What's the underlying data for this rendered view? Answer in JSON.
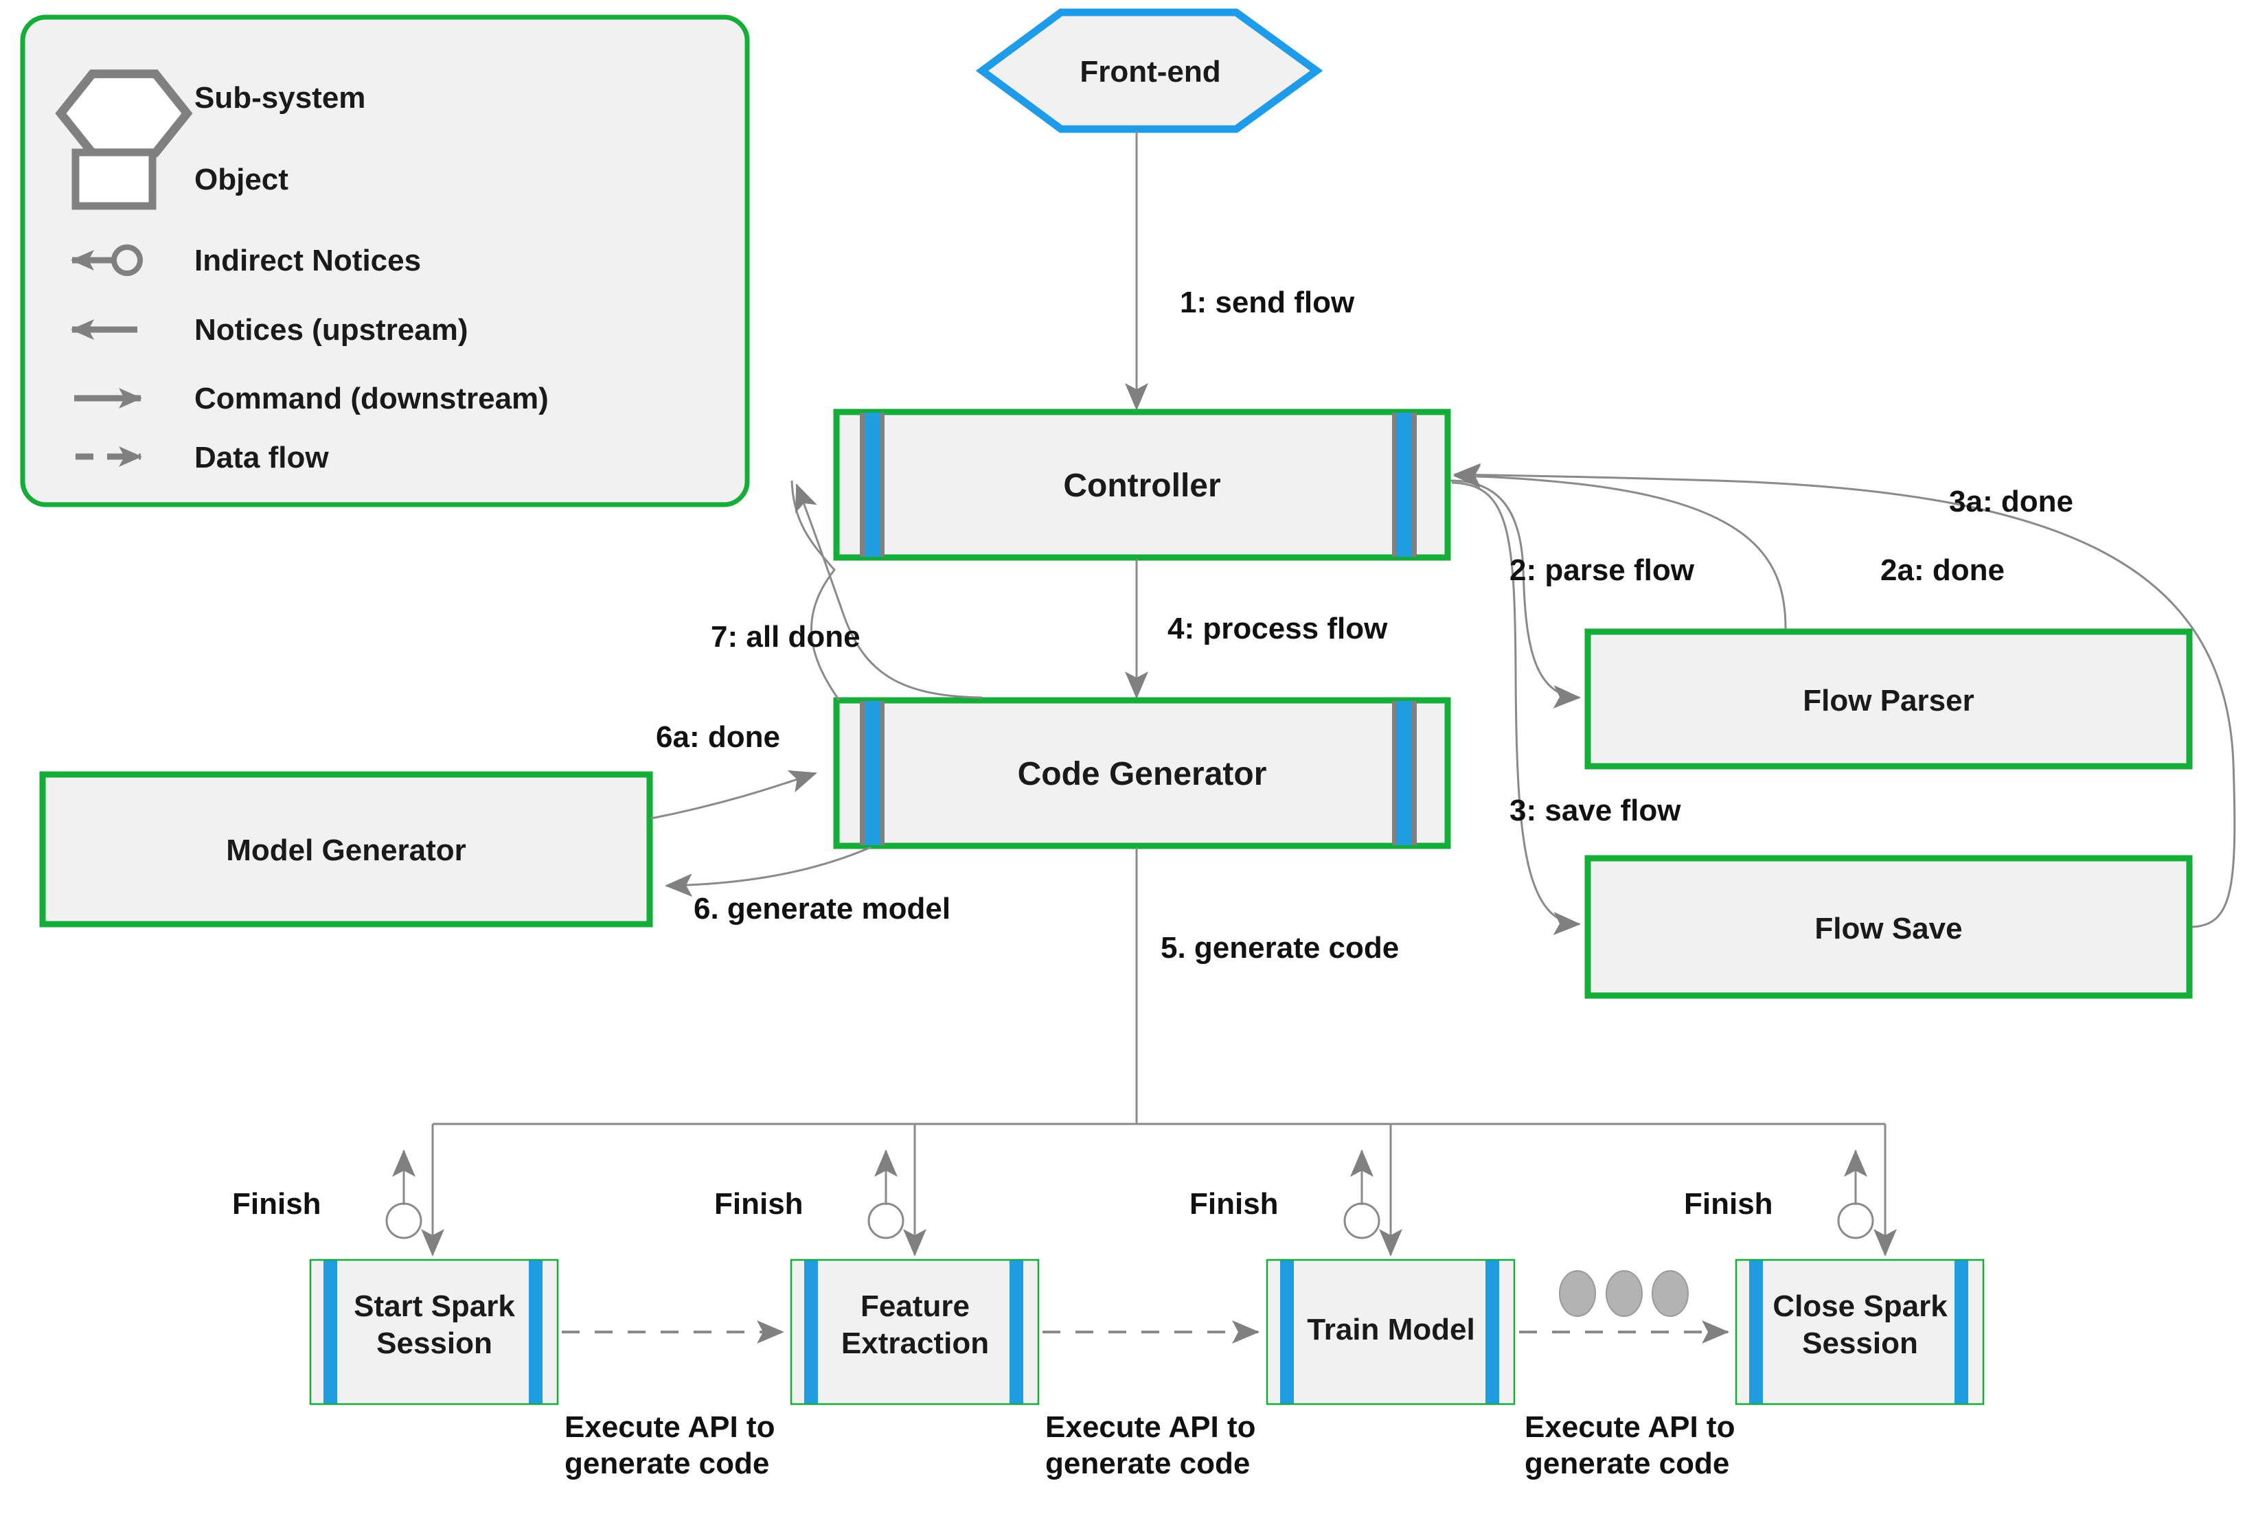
{
  "diagram": {
    "title": "Flow-to-code generation sub-system interaction diagram",
    "colors": {
      "green_border": "#13ad38",
      "blue_stripe": "#1f9de0",
      "gray_stripe": "#808080",
      "node_fill": "#f1f1f1",
      "front_end_border": "#1e9cea",
      "arrow_gray": "#808080",
      "line_gray": "#8a8a8a",
      "text": "#1a1a1a"
    }
  },
  "legend": {
    "title": "",
    "items": [
      {
        "icon": "hexagon-icon",
        "label": "Sub-system"
      },
      {
        "icon": "rectangle-icon",
        "label": "Object"
      },
      {
        "icon": "indirect-notice-icon",
        "label": "Indirect Notices"
      },
      {
        "icon": "notice-upstream-icon",
        "label": "Notices (upstream)"
      },
      {
        "icon": "command-downstream-icon",
        "label": "Command (downstream)"
      },
      {
        "icon": "data-flow-icon",
        "label": "Data flow"
      }
    ]
  },
  "nodes": {
    "front_end": {
      "label": "Front-end",
      "shape": "hexagon"
    },
    "controller": {
      "label": "Controller",
      "shape": "striped-box"
    },
    "code_generator": {
      "label": "Code Generator",
      "shape": "striped-box"
    },
    "model_generator": {
      "label": "Model Generator",
      "shape": "box"
    },
    "flow_parser": {
      "label": "Flow Parser",
      "shape": "box"
    },
    "flow_save": {
      "label": "Flow Save",
      "shape": "box"
    },
    "start_spark": {
      "label": "Start Spark\nSession",
      "shape": "striped-box"
    },
    "feature_extract": {
      "label": "Feature\nExtraction",
      "shape": "striped-box"
    },
    "train_model": {
      "label": "Train Model",
      "shape": "striped-box"
    },
    "close_spark": {
      "label": "Close Spark\nSession",
      "shape": "striped-box"
    }
  },
  "edge_labels": {
    "send_flow": "1: send flow",
    "parse_flow": "2: parse flow",
    "parse_done": "2a: done",
    "save_flow": "3: save flow",
    "save_done": "3a: done",
    "process_flow": "4: process flow",
    "generate_code": "5. generate code",
    "generate_model": "6. generate model",
    "model_done": "6a: done",
    "all_done": "7: all done",
    "finish_1": "Finish",
    "finish_2": "Finish",
    "finish_3": "Finish",
    "finish_4": "Finish",
    "execute_api_1": "Execute API to\ngenerate code",
    "execute_api_2": "Execute API to\ngenerate code",
    "execute_api_3": "Execute API to\ngenerate code"
  },
  "ellipsis": {
    "label": "…",
    "dot_count": 3
  }
}
